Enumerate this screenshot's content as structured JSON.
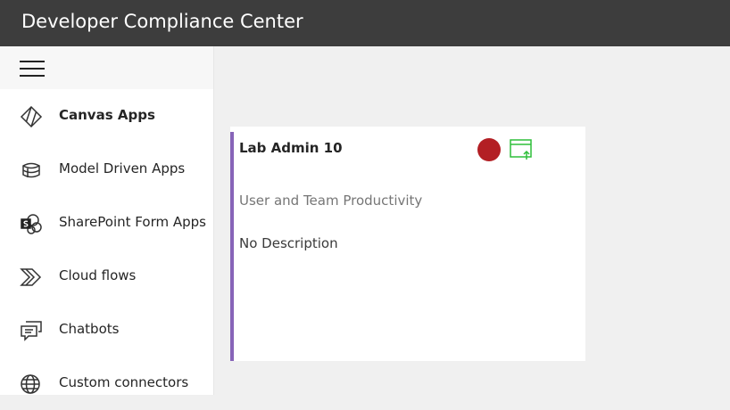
{
  "app": {
    "title": "Developer Compliance Center"
  },
  "sidebar": {
    "menu_icon": "hamburger-menu-icon",
    "items": [
      {
        "label": "Canvas Apps",
        "icon": "canvas-apps-icon",
        "active": true
      },
      {
        "label": "Model Driven Apps",
        "icon": "model-driven-apps-icon",
        "active": false
      },
      {
        "label": "SharePoint Form Apps",
        "icon": "sharepoint-icon",
        "active": false
      },
      {
        "label": "Cloud flows",
        "icon": "cloud-flows-icon",
        "active": false
      },
      {
        "label": "Chatbots",
        "icon": "chatbots-icon",
        "active": false
      },
      {
        "label": "Custom connectors",
        "icon": "globe-icon",
        "active": false
      }
    ]
  },
  "card": {
    "title": "Lab Admin 10",
    "category": "User and Team Productivity",
    "description": "No Description",
    "status_icon": "status-dot-icon",
    "action_icon": "publish-window-icon"
  },
  "colors": {
    "topbar": "#3d3d3d",
    "accent": "#8764b8",
    "status": "#b31f24",
    "action_icon": "#2fbf3a"
  }
}
